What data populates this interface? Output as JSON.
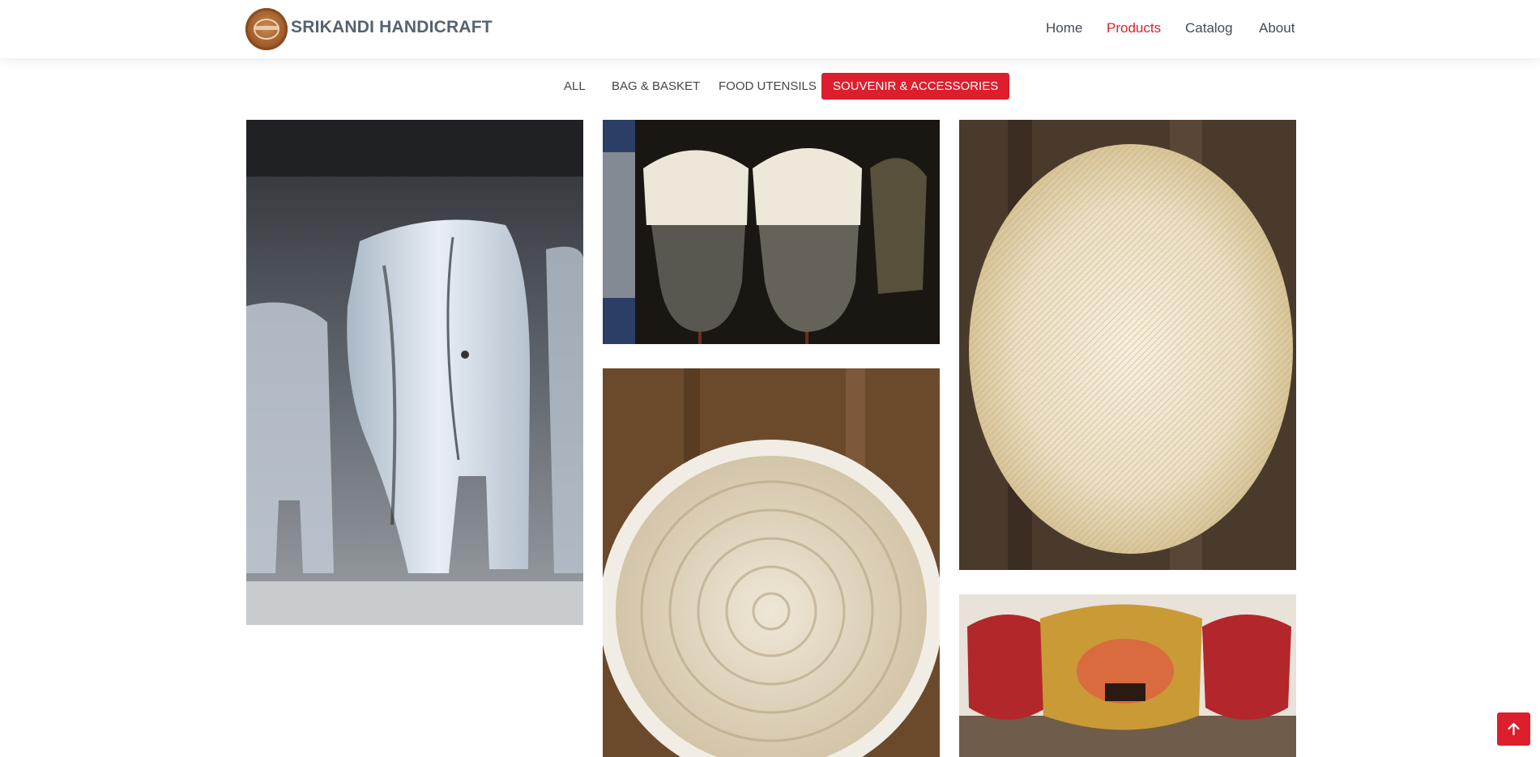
{
  "header": {
    "brand": "SRIKANDI HANDICRAFT",
    "logo_icon": "brand-logo-icon",
    "nav": [
      {
        "label": "Home",
        "active": false
      },
      {
        "label": "Products",
        "active": true
      },
      {
        "label": "Catalog",
        "active": false
      },
      {
        "label": "About",
        "active": false
      }
    ]
  },
  "filters": [
    {
      "label": "ALL",
      "active": false
    },
    {
      "label": "BAG & BASKET",
      "active": false
    },
    {
      "label": "FOOD UTENSILS",
      "active": false
    },
    {
      "label": "SOUVENIR & ACCESSORIES",
      "active": true
    }
  ],
  "gallery": [
    {
      "subject": "wooden elephant carvings"
    },
    {
      "subject": "shell-decorated wooden masks"
    },
    {
      "subject": "woven rattan oval placemat"
    },
    {
      "subject": "cowrie shell rope placemat"
    },
    {
      "subject": "balinese barong masks"
    }
  ],
  "back_to_top_icon": "arrow-up-icon",
  "colors": {
    "accent": "#dc1e2d",
    "brand_text": "#556270"
  }
}
